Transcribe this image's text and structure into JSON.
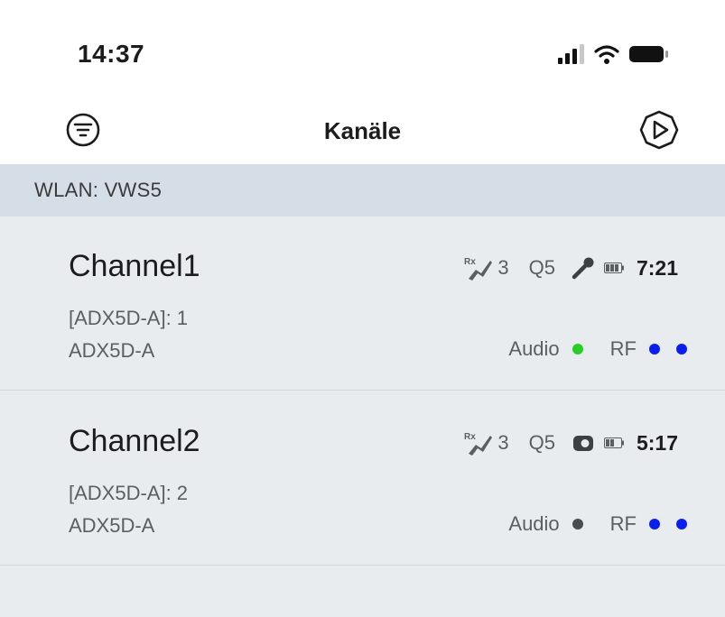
{
  "status_bar": {
    "time": "14:37",
    "icons": [
      "signal-icon",
      "wifi-icon",
      "battery-icon"
    ]
  },
  "nav": {
    "title": "Kanäle",
    "left_icon": "menu-filter-icon",
    "right_icon": "scan-icon"
  },
  "section": {
    "title": "WLAN: VWS5"
  },
  "channels": [
    {
      "name": "Channel1",
      "device_id": "[ADX5D-A]: 1",
      "model": "ADX5D-A",
      "rx_icon": "rx-antenna-icon",
      "rx_count": "3",
      "quality": "Q5",
      "tx_icon": "handheld-mic-icon",
      "battery_icon": "battery-icon",
      "runtime": "7:21",
      "audio_label": "Audio",
      "audio_color": "#25d024",
      "rf_label": "RF",
      "rf_color": "#0a1ef0"
    },
    {
      "name": "Channel2",
      "device_id": "[ADX5D-A]: 2",
      "model": "ADX5D-A",
      "rx_icon": "rx-antenna-icon",
      "rx_count": "3",
      "quality": "Q5",
      "tx_icon": "bodypack-icon",
      "battery_icon": "battery-icon",
      "runtime": "5:17",
      "audio_label": "Audio",
      "audio_color": "#4a4d50",
      "rf_label": "RF",
      "rf_color": "#0a1ef0"
    }
  ],
  "colors": {
    "section_bg": "#d5dee6",
    "list_bg": "#e9ecee",
    "text_primary": "#1c1c1e",
    "text_secondary": "#5b5f63"
  }
}
